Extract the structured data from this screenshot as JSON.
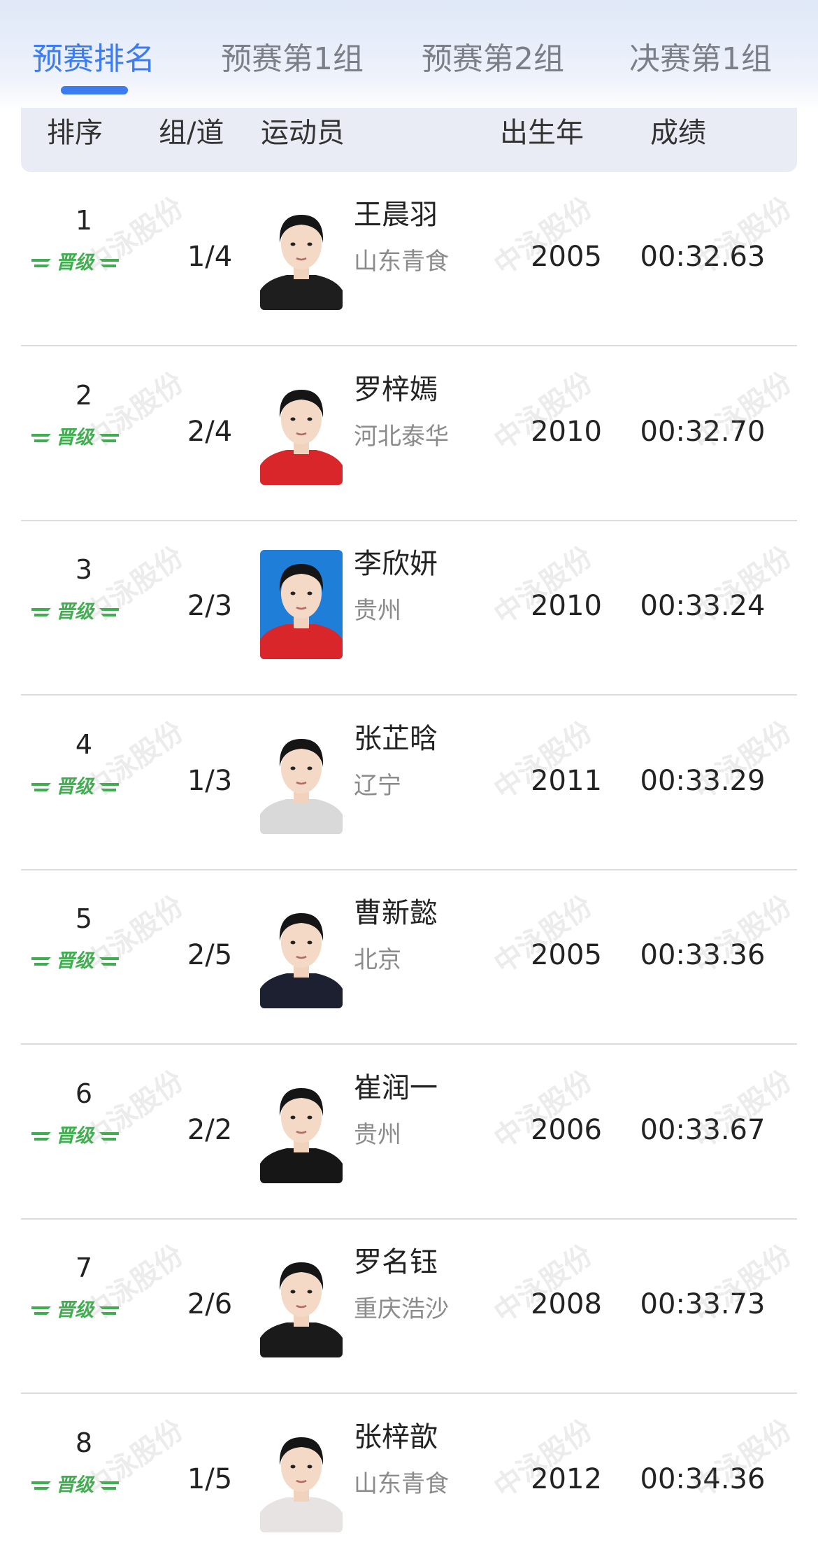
{
  "tabs": [
    {
      "label": "预赛排名",
      "active": true
    },
    {
      "label": "预赛第1组",
      "active": false
    },
    {
      "label": "预赛第2组",
      "active": false
    },
    {
      "label": "决赛第1组",
      "active": false
    }
  ],
  "columns": {
    "rank": "排序",
    "lane": "组/道",
    "athlete": "运动员",
    "birth_year": "出生年",
    "result": "成绩"
  },
  "qualified_label": "晋级",
  "watermark": "中泳股份",
  "rows": [
    {
      "rank": "1",
      "lane": "1/4",
      "name": "王晨羽",
      "team": "山东青食",
      "year": "2005",
      "time": "00:32.63",
      "shirt": "#1e1e1e",
      "bg": "#ffffff"
    },
    {
      "rank": "2",
      "lane": "2/4",
      "name": "罗梓嫣",
      "team": "河北泰华",
      "year": "2010",
      "time": "00:32.70",
      "shirt": "#d8262b",
      "bg": "#ffffff"
    },
    {
      "rank": "3",
      "lane": "2/3",
      "name": "李欣妍",
      "team": "贵州",
      "year": "2010",
      "time": "00:33.24",
      "shirt": "#d8262b",
      "bg": "#1f7fd8"
    },
    {
      "rank": "4",
      "lane": "1/3",
      "name": "张芷晗",
      "team": "辽宁",
      "year": "2011",
      "time": "00:33.29",
      "shirt": "#d9d9d9",
      "bg": "#ffffff"
    },
    {
      "rank": "5",
      "lane": "2/5",
      "name": "曹新懿",
      "team": "北京",
      "year": "2005",
      "time": "00:33.36",
      "shirt": "#1c2030",
      "bg": "#ffffff"
    },
    {
      "rank": "6",
      "lane": "2/2",
      "name": "崔润一",
      "team": "贵州",
      "year": "2006",
      "time": "00:33.67",
      "shirt": "#161616",
      "bg": "#ffffff"
    },
    {
      "rank": "7",
      "lane": "2/6",
      "name": "罗名钰",
      "team": "重庆浩沙",
      "year": "2008",
      "time": "00:33.73",
      "shirt": "#1a1a1a",
      "bg": "#ffffff"
    },
    {
      "rank": "8",
      "lane": "1/5",
      "name": "张梓歆",
      "team": "山东青食",
      "year": "2012",
      "time": "00:34.36",
      "shirt": "#e8e3e3",
      "bg": "#ffffff"
    }
  ],
  "colors": {
    "accent": "#3d7cf0",
    "qualified_green": "#3fae4e"
  }
}
